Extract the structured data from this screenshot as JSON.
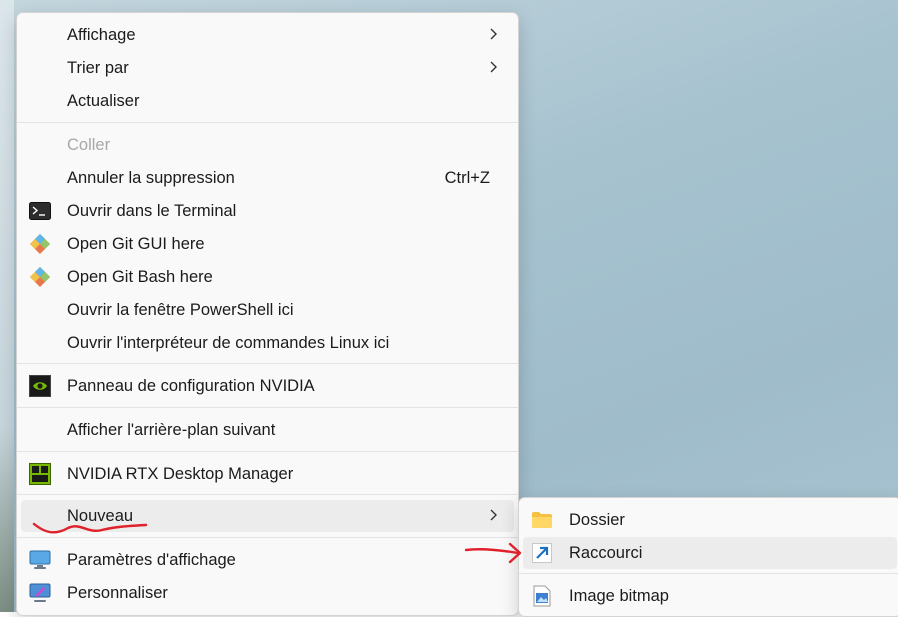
{
  "context_menu": {
    "items": [
      {
        "label": "Affichage",
        "submenu": true
      },
      {
        "label": "Trier par",
        "submenu": true
      },
      {
        "label": "Actualiser"
      },
      {
        "label": "Coller",
        "disabled": true
      },
      {
        "label": "Annuler la suppression",
        "shortcut": "Ctrl+Z"
      },
      {
        "label": "Ouvrir dans le Terminal",
        "icon": "terminal-icon"
      },
      {
        "label": "Open Git GUI here",
        "icon": "git-icon"
      },
      {
        "label": "Open Git Bash here",
        "icon": "git-icon"
      },
      {
        "label": "Ouvrir la fenêtre PowerShell ici"
      },
      {
        "label": "Ouvrir l'interpréteur de commandes Linux ici"
      },
      {
        "label": "Panneau de configuration NVIDIA",
        "icon": "nvidia-icon"
      },
      {
        "label": "Afficher l'arrière-plan suivant"
      },
      {
        "label": "NVIDIA RTX Desktop Manager",
        "icon": "nvidia-rtx-icon"
      },
      {
        "label": "Nouveau",
        "submenu": true,
        "highlighted": true
      },
      {
        "label": "Paramètres d'affichage",
        "icon": "display-settings-icon"
      },
      {
        "label": "Personnaliser",
        "icon": "personalize-icon"
      }
    ]
  },
  "new_submenu": {
    "items": [
      {
        "label": "Dossier",
        "icon": "folder-icon"
      },
      {
        "label": "Raccourci",
        "icon": "shortcut-icon",
        "highlighted": true
      },
      {
        "label": "Image bitmap",
        "icon": "bitmap-icon"
      }
    ]
  },
  "colors": {
    "menu_background": "#f9f9f9",
    "hover_background": "#ececec",
    "disabled_text": "#a8a8a8",
    "annotation_red": "#e0202a",
    "folder_yellow": "#f4c143",
    "shortcut_blue": "#1f6fbf"
  }
}
